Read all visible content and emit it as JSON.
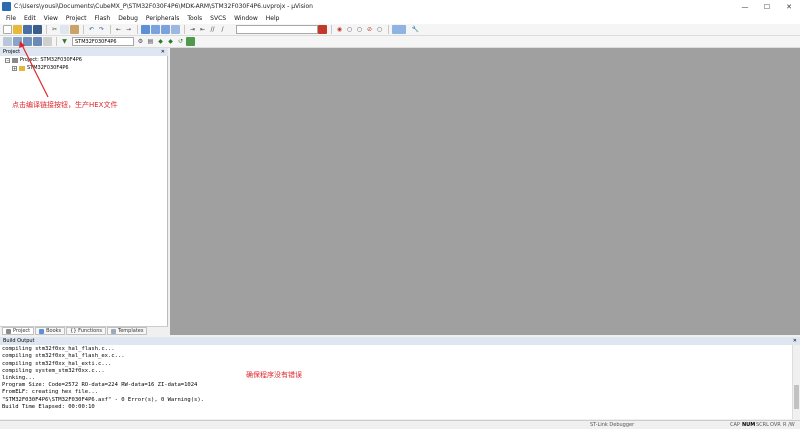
{
  "window": {
    "title": "C:\\Users\\yousi\\Documents\\CubeMX_P\\STM32F030F4P6\\MDK-ARM\\STM32F030F4P6.uvprojx - µVision"
  },
  "menu": [
    "File",
    "Edit",
    "View",
    "Project",
    "Flash",
    "Debug",
    "Peripherals",
    "Tools",
    "SVCS",
    "Window",
    "Help"
  ],
  "toolbar": {
    "target": "STM32F030F4P6"
  },
  "project_panel": {
    "title": "Project",
    "tree": [
      {
        "label": "Project: STM32F030F4P6",
        "expanded": true
      },
      {
        "label": "STM32F030F4P6",
        "expanded": false
      }
    ],
    "tabs": [
      "Project",
      "Books",
      "{} Functions",
      "Templates"
    ]
  },
  "annotations": {
    "build_button_note": "点击编译链接按钮，生产HEX文件",
    "no_error_note": "确保程序没有错误"
  },
  "build_output": {
    "title": "Build Output",
    "lines": [
      "compiling stm32f0xx_hal_flash.c...",
      "compiling stm32f0xx_hal_flash_ex.c...",
      "compiling stm32f0xx_hal_exti.c...",
      "compiling system_stm32f0xx.c...",
      "linking...",
      "Program Size: Code=2572 RO-data=224 RW-data=16 ZI-data=1024",
      "FromELF: creating hex file...",
      "\"STM32F030F4P6\\STM32F030F4P6.axf\" - 0 Error(s), 0 Warning(s).",
      "Build Time Elapsed:  00:00:10"
    ]
  },
  "status_bar": {
    "debugger": "ST-Link Debugger",
    "indicators": [
      "CAP",
      "NUM",
      "SCRL",
      "OVR",
      "R /W"
    ]
  },
  "colors": {
    "annotation": "#e0242a",
    "panel_header": "#dde6f1",
    "editor_bg": "#a0a0a0"
  }
}
